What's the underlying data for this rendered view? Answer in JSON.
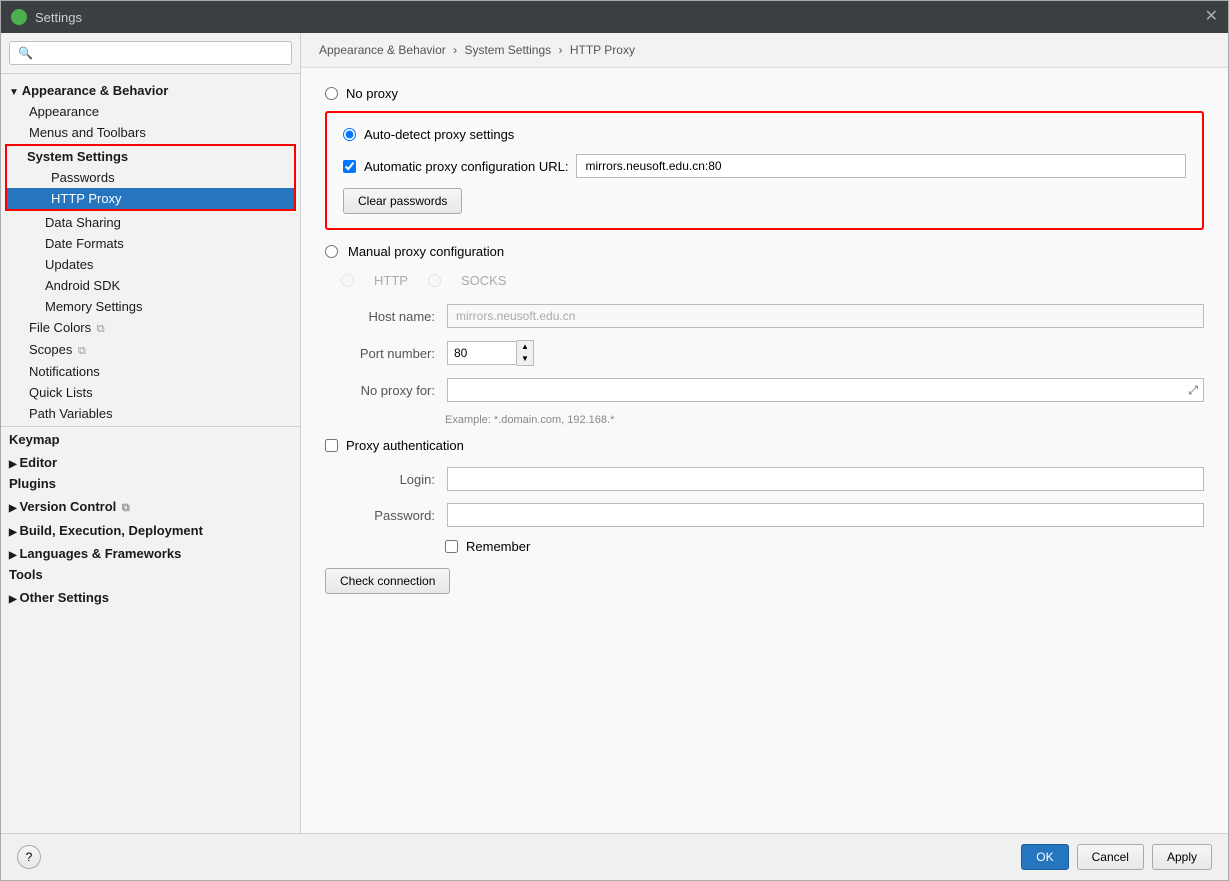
{
  "titlebar": {
    "title": "Settings",
    "close_label": "✕"
  },
  "breadcrumb": {
    "part1": "Appearance & Behavior",
    "sep1": "›",
    "part2": "System Settings",
    "sep2": "›",
    "part3": "HTTP Proxy"
  },
  "sidebar": {
    "search_placeholder": "🔍",
    "items": [
      {
        "id": "appearance-behavior",
        "label": "Appearance & Behavior",
        "level": 0,
        "type": "section",
        "state": "expanded"
      },
      {
        "id": "appearance",
        "label": "Appearance",
        "level": 1
      },
      {
        "id": "menus-toolbars",
        "label": "Menus and Toolbars",
        "level": 1
      },
      {
        "id": "system-settings",
        "label": "System Settings",
        "level": 1,
        "type": "section",
        "state": "expanded",
        "boxed": true
      },
      {
        "id": "passwords",
        "label": "Passwords",
        "level": 2
      },
      {
        "id": "http-proxy",
        "label": "HTTP Proxy",
        "level": 2,
        "selected": true
      },
      {
        "id": "data-sharing",
        "label": "Data Sharing",
        "level": 2
      },
      {
        "id": "date-formats",
        "label": "Date Formats",
        "level": 2
      },
      {
        "id": "updates",
        "label": "Updates",
        "level": 2
      },
      {
        "id": "android-sdk",
        "label": "Android SDK",
        "level": 2
      },
      {
        "id": "memory-settings",
        "label": "Memory Settings",
        "level": 2
      },
      {
        "id": "file-colors",
        "label": "File Colors",
        "level": 1
      },
      {
        "id": "scopes",
        "label": "Scopes",
        "level": 1
      },
      {
        "id": "notifications",
        "label": "Notifications",
        "level": 1
      },
      {
        "id": "quick-lists",
        "label": "Quick Lists",
        "level": 1
      },
      {
        "id": "path-variables",
        "label": "Path Variables",
        "level": 1
      },
      {
        "id": "keymap",
        "label": "Keymap",
        "level": 0,
        "type": "section-plain"
      },
      {
        "id": "editor",
        "label": "Editor",
        "level": 0,
        "type": "section",
        "state": "collapsed"
      },
      {
        "id": "plugins",
        "label": "Plugins",
        "level": 0,
        "type": "section-plain"
      },
      {
        "id": "version-control",
        "label": "Version Control",
        "level": 0,
        "type": "section",
        "state": "collapsed"
      },
      {
        "id": "build-exec-deploy",
        "label": "Build, Execution, Deployment",
        "level": 0,
        "type": "section",
        "state": "collapsed"
      },
      {
        "id": "languages-frameworks",
        "label": "Languages & Frameworks",
        "level": 0,
        "type": "section",
        "state": "collapsed"
      },
      {
        "id": "tools",
        "label": "Tools",
        "level": 0,
        "type": "section-plain"
      },
      {
        "id": "other-settings",
        "label": "Other Settings",
        "level": 0,
        "type": "section",
        "state": "collapsed"
      }
    ]
  },
  "proxy": {
    "no_proxy_label": "No proxy",
    "auto_detect_label": "Auto-detect proxy settings",
    "auto_url_label": "Automatic proxy configuration URL:",
    "auto_url_value": "mirrors.neusoft.edu.cn:80",
    "clear_passwords_label": "Clear passwords",
    "manual_label": "Manual proxy configuration",
    "http_label": "HTTP",
    "socks_label": "SOCKS",
    "host_label": "Host name:",
    "host_value": "mirrors.neusoft.edu.cn",
    "port_label": "Port number:",
    "port_value": "80",
    "no_proxy_label2": "No proxy for:",
    "no_proxy_value": "",
    "example_text": "Example: *.domain.com, 192.168.*",
    "proxy_auth_label": "Proxy authentication",
    "login_label": "Login:",
    "login_value": "",
    "password_label": "Password:",
    "password_value": "",
    "remember_label": "Remember",
    "check_connection_label": "Check connection"
  },
  "footer": {
    "ok_label": "OK",
    "cancel_label": "Cancel",
    "apply_label": "Apply",
    "help_label": "?"
  }
}
